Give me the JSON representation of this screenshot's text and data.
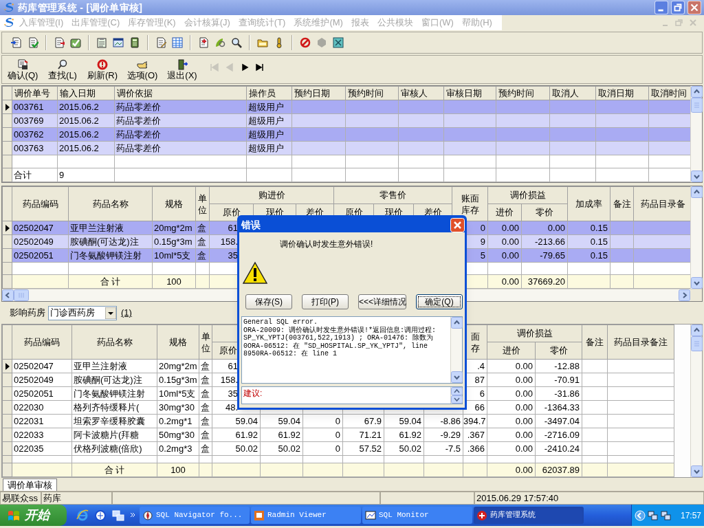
{
  "window": {
    "title": "药库管理系统 - [调价单审核]"
  },
  "menu": [
    {
      "label": "入库管理(I)",
      "disabled": true
    },
    {
      "label": "出库管理(C)",
      "disabled": true
    },
    {
      "label": "库存管理(K)",
      "disabled": true
    },
    {
      "label": "会计核算(J)",
      "disabled": true
    },
    {
      "label": "查询统计(T)",
      "disabled": true
    },
    {
      "label": "系统维护(M)",
      "disabled": true
    },
    {
      "label": "报表",
      "disabled": true
    },
    {
      "label": "公共模块",
      "disabled": true
    },
    {
      "label": "窗口(W)",
      "disabled": true
    },
    {
      "label": "帮助(H)",
      "disabled": true
    }
  ],
  "actions": [
    {
      "label": "确认(Q)",
      "kind": "confirm"
    },
    {
      "label": "查找(L)",
      "kind": "find"
    },
    {
      "label": "刷新(R)",
      "kind": "refresh"
    },
    {
      "label": "选项(O)",
      "kind": "options"
    },
    {
      "label": "退出(X)",
      "kind": "exit"
    }
  ],
  "record_nav": [
    {
      "kind": "first",
      "disabled": true
    },
    {
      "kind": "prev",
      "disabled": true
    },
    {
      "kind": "next",
      "disabled": false
    },
    {
      "kind": "last",
      "disabled": false
    }
  ],
  "orders_grid": {
    "striped": true,
    "header": [
      {
        "label": "调价单号"
      },
      {
        "label": "输入日期"
      },
      {
        "label": "调价依据"
      },
      {
        "label": "操作员"
      },
      {
        "label": "预约日期"
      },
      {
        "label": "预约时间"
      },
      {
        "label": "审核人"
      },
      {
        "label": "审核日期"
      },
      {
        "label": "预约时间"
      },
      {
        "label": "取消人"
      },
      {
        "label": "取消日期"
      },
      {
        "label": "取消时间"
      }
    ],
    "rows": [
      {
        "kind": "data",
        "selected": true,
        "cells": [
          "003761",
          "2015.06.2",
          "药品零差价",
          "超级用户"
        ]
      },
      {
        "kind": "data",
        "selected": false,
        "cells": [
          "003769",
          "2015.06.2",
          "药品零差价",
          "超级用户"
        ]
      },
      {
        "kind": "data",
        "selected": false,
        "cells": [
          "003762",
          "2015.06.2",
          "药品零差价",
          "超级用户"
        ]
      },
      {
        "kind": "data",
        "selected": false,
        "cells": [
          "003763",
          "2015.06.2",
          "药品零差价",
          "超级用户"
        ]
      },
      {
        "kind": "blank"
      },
      {
        "kind": "total",
        "shaded": false,
        "cells": [
          "合计",
          "9"
        ]
      }
    ]
  },
  "items_grid": {
    "striped": true,
    "header": [
      {
        "label": "药品编码"
      },
      {
        "label": "药品名称"
      },
      {
        "label": "规格"
      },
      {
        "label": "单位"
      },
      {
        "label": "购进价",
        "children": [
          {
            "label": "原价",
            "kind": "number"
          },
          {
            "label": "现价",
            "kind": "number"
          },
          {
            "label": "差价",
            "kind": "number"
          }
        ]
      },
      {
        "label": "零售价",
        "children": [
          {
            "label": "原价",
            "kind": "number"
          },
          {
            "label": "现价",
            "kind": "number"
          },
          {
            "label": "差价",
            "kind": "number"
          }
        ]
      },
      {
        "lines": [
          "账面",
          "库存"
        ],
        "kind": "number"
      },
      {
        "label": "调价损益",
        "children": [
          {
            "label": "进价",
            "kind": "number"
          },
          {
            "label": "零价",
            "kind": "number"
          }
        ]
      },
      {
        "label": "加成率",
        "kind": "number"
      },
      {
        "label": "备注"
      },
      {
        "label": "药品目录备"
      }
    ],
    "rows": [
      {
        "kind": "data",
        "selected": true,
        "cells": [
          "02502047",
          "亚甲兰注射液",
          "20mg*2m",
          "盒",
          "61",
          null,
          null,
          null,
          null,
          null,
          "0",
          "0.00",
          "0.00",
          "0.15"
        ]
      },
      {
        "kind": "data",
        "selected": false,
        "cells": [
          "02502049",
          "胺碘酮(可达龙)注",
          "0.15g*3m",
          "盒",
          "158.",
          null,
          null,
          null,
          null,
          null,
          "9",
          "0.00",
          "-213.66",
          "0.15"
        ]
      },
      {
        "kind": "data",
        "selected": false,
        "cells": [
          "02502051",
          "门冬氨酸钾镁注射",
          "10ml*5支",
          "盒",
          "35",
          null,
          null,
          null,
          null,
          null,
          "5",
          "0.00",
          "-79.65",
          "0.15"
        ]
      },
      {
        "kind": "blank"
      },
      {
        "kind": "total",
        "shaded": true,
        "cells": [
          null,
          "合 计",
          "100",
          null,
          null,
          null,
          null,
          null,
          null,
          null,
          null,
          "0.00",
          "37669.20"
        ]
      }
    ]
  },
  "pharmacy": {
    "label": "影响药房",
    "value": "门诊西药房",
    "link": "(1)"
  },
  "affected_grid": {
    "striped": false,
    "header": [
      {
        "label": "药品编码"
      },
      {
        "label": "药品名称"
      },
      {
        "label": "规格"
      },
      {
        "label": "单位"
      },
      {
        "children": [
          {
            "label": "原价",
            "kind": "number"
          },
          {
            "kind": "number"
          },
          {
            "kind": "number"
          }
        ]
      },
      {
        "children": [
          {
            "kind": "number"
          },
          {
            "kind": "number"
          },
          {
            "kind": "number"
          }
        ]
      },
      {
        "lines": [
          "面",
          "存"
        ],
        "kind": "number"
      },
      {
        "label": "调价损益",
        "children": [
          {
            "label": "进价",
            "kind": "number"
          },
          {
            "label": "零价",
            "kind": "number"
          }
        ]
      },
      {
        "label": "备注"
      },
      {
        "label": "药品目录备注"
      }
    ],
    "rows": [
      {
        "kind": "data",
        "selected": true,
        "cells": [
          "02502047",
          "亚甲兰注射液",
          "20mg*2m",
          "盒",
          "61",
          null,
          null,
          null,
          null,
          null,
          ".4",
          "0.00",
          "-12.88"
        ]
      },
      {
        "kind": "data",
        "selected": false,
        "cells": [
          "02502049",
          "胺碘酮(可达龙)注",
          "0.15g*3m",
          "盒",
          "158.",
          null,
          null,
          null,
          null,
          null,
          "87",
          "0.00",
          "-70.91"
        ]
      },
      {
        "kind": "data",
        "selected": false,
        "cells": [
          "02502051",
          "门冬氨酸钾镁注射",
          "10ml*5支",
          "盒",
          "35",
          null,
          null,
          null,
          null,
          null,
          "6",
          "0.00",
          "-31.86"
        ]
      },
      {
        "kind": "data",
        "selected": false,
        "cells": [
          "022030",
          "格列齐特缓释片(",
          "30mg*30",
          "盒",
          "48.",
          null,
          null,
          null,
          null,
          null,
          "66",
          "0.00",
          "-1364.33"
        ]
      },
      {
        "kind": "data",
        "selected": false,
        "cells": [
          "022031",
          "坦索罗辛缓释胶囊",
          "0.2mg*1",
          "盒",
          "59.04",
          "59.04",
          "0",
          "67.9",
          "59.04",
          "-8.86",
          "394.7",
          "0.00",
          "-3497.04"
        ]
      },
      {
        "kind": "data",
        "selected": false,
        "cells": [
          "022033",
          "阿卡波糖片(拜糖",
          "50mg*30",
          "盒",
          "61.92",
          "61.92",
          "0",
          "71.21",
          "61.92",
          "-9.29",
          ".367",
          "0.00",
          "-2716.09"
        ]
      },
      {
        "kind": "data",
        "selected": false,
        "cells": [
          "022035",
          "伏格列波糖(倍欣)",
          "0.2mg*3",
          "盒",
          "50.02",
          "50.02",
          "0",
          "57.52",
          "50.02",
          "-7.5",
          ".366",
          "0.00",
          "-2410.24"
        ]
      },
      {
        "kind": "blank"
      },
      {
        "kind": "total",
        "shaded": true,
        "cells": [
          null,
          "合 计",
          "100",
          null,
          null,
          null,
          null,
          null,
          null,
          null,
          null,
          "0.00",
          "62037.89"
        ]
      }
    ]
  },
  "tabs": [
    {
      "label": "调价单审核",
      "selected": true
    }
  ],
  "status_bar": {
    "user": "易联众ss",
    "module": "药库",
    "datetime": "2015.06.29 17:57:40"
  },
  "error_dialog": {
    "title": "错误",
    "message": "调价确认时发生意外错误!",
    "buttons": [
      {
        "label": "保存(S)",
        "default": false
      },
      {
        "label": "打印(P)",
        "default": false
      },
      {
        "label": "<<<详细情况",
        "default": false
      },
      {
        "label": "确定(Q)",
        "default": true
      }
    ],
    "details": "General SQL error.\nORA-20009: 调价确认时发生意外错误!*返回信息:调用过程: SP_YK_YPTJ(003761,522,1913) ; ORA-01476: 除数为 0ORA-06512: 在 \"SD_HOSPITAL.SP_YK_YPTJ\", line 8950RA-06512: 在 line 1",
    "suggestion": "建议:"
  },
  "taskbar": {
    "start": "开始",
    "tasks": [
      {
        "label": "SQL Navigator fo...",
        "kind": "navigator",
        "selected": false
      },
      {
        "label": "Radmin Viewer",
        "kind": "radmin",
        "selected": false
      },
      {
        "label": "SQL Monitor",
        "kind": "monitor",
        "selected": false
      },
      {
        "label": "药库管理系统",
        "kind": "pharmacy",
        "selected": true
      }
    ],
    "clock": "17:57"
  }
}
